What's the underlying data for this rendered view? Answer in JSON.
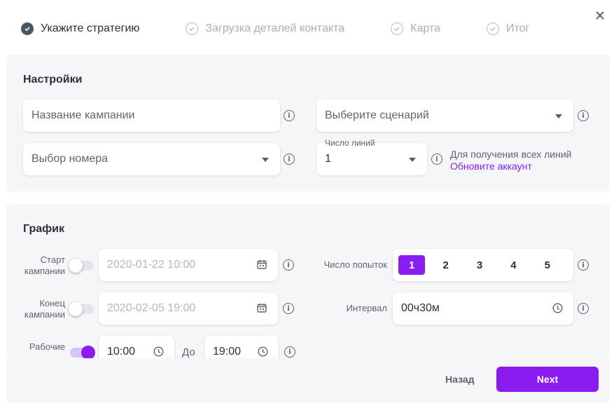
{
  "steps": [
    {
      "label": "Укажите стратегию",
      "active": true
    },
    {
      "label": "Загрузка деталей контакта",
      "active": false
    },
    {
      "label": "Карта",
      "active": false
    },
    {
      "label": "Итог",
      "active": false
    }
  ],
  "settings": {
    "title": "Настройки",
    "campaign_name_placeholder": "Название кампании",
    "scenario_placeholder": "Выберите сценарий",
    "number_placeholder": "Выбор номера",
    "lines_label": "Число линий",
    "lines_value": "1",
    "upgrade_hint": "Для получения всех линий",
    "upgrade_link": "Обновите аккаунт"
  },
  "schedule": {
    "title": "График",
    "start_label": "Старт кампании",
    "start_value": "2020-01-22 10:00",
    "start_enabled": false,
    "end_label": "Конец кампании",
    "end_value": "2020-02-05 19:00",
    "end_enabled": false,
    "work_label": "Рабочие",
    "work_enabled": true,
    "work_from": "10:00",
    "work_to_label": "До",
    "work_to": "19:00",
    "attempts_label": "Число попыток",
    "attempts": [
      "1",
      "2",
      "3",
      "4",
      "5"
    ],
    "attempts_selected": "1",
    "interval_label": "Интервал",
    "interval_value": "00ч30м"
  },
  "footer": {
    "back_label": "Назад",
    "next_label": "Next"
  },
  "colors": {
    "accent": "#8a1cf0",
    "panel_bg": "#f5f6f8",
    "text": "#2d2f3a"
  }
}
